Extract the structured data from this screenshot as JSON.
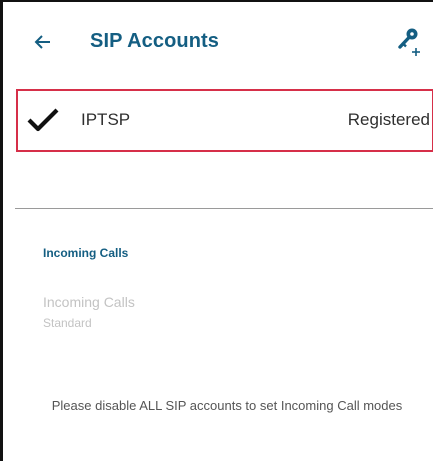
{
  "header": {
    "title": "SIP Accounts",
    "back_icon": "arrow-left-icon",
    "add_icon": "key-plus-icon",
    "accent_color": "#145e82"
  },
  "accounts": [
    {
      "name": "IPTSP",
      "status": "Registered",
      "checked": true,
      "check_icon": "checkmark-icon",
      "highlight_color": "#d62f49"
    }
  ],
  "incoming_section": {
    "header": "Incoming Calls",
    "preference": {
      "title": "Incoming Calls",
      "summary": "Standard",
      "enabled": false
    },
    "note": "Please disable ALL SIP accounts to set Incoming Call modes"
  }
}
